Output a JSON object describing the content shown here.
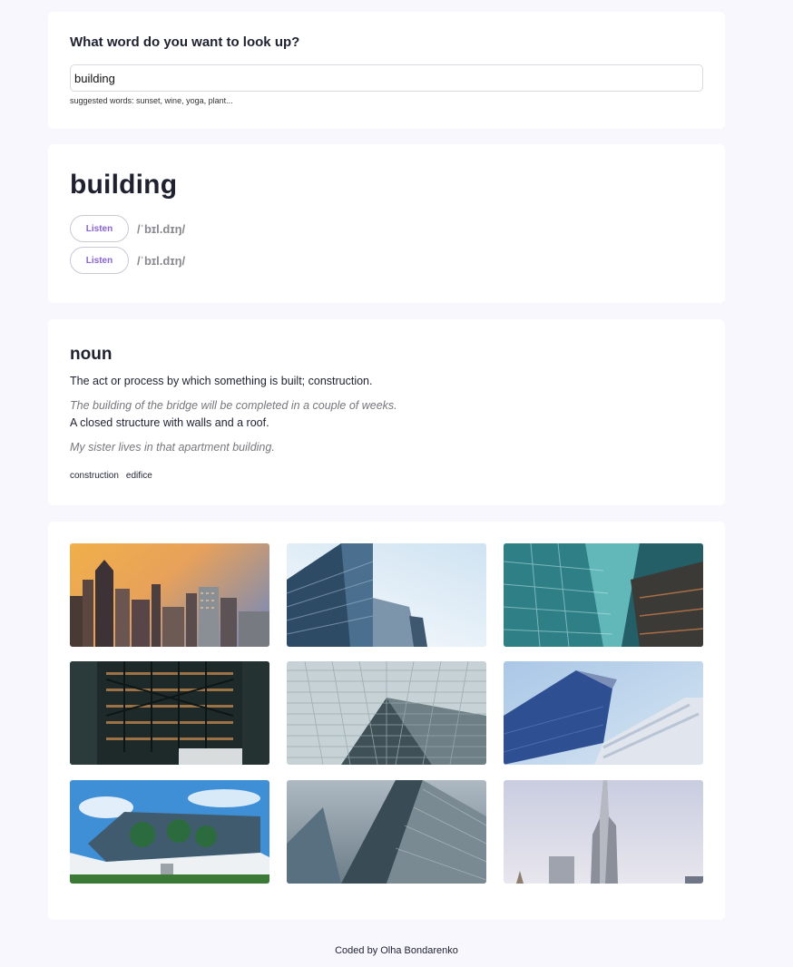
{
  "search": {
    "heading": "What word do you want to look up?",
    "value": "building",
    "suggestions": "suggested words: sunset, wine, yoga, plant..."
  },
  "word": {
    "title": "building",
    "phonetics": [
      {
        "button_label": "Listen",
        "text": "/ˈbɪl.dɪŋ/"
      },
      {
        "button_label": "Listen",
        "text": "/ˈbɪl.dɪŋ/"
      }
    ]
  },
  "meaning": {
    "part_of_speech": "noun",
    "definitions": [
      {
        "definition": "The act or process by which something is built; construction.",
        "example": "The building of the bridge will be completed in a couple of weeks."
      },
      {
        "definition": "A closed structure with walls and a roof.",
        "example": "My sister lives in that apartment building."
      }
    ],
    "synonyms": [
      "construction",
      "edifice"
    ]
  },
  "photos": [
    {
      "name": "city-skyline-sunset-photo"
    },
    {
      "name": "blue-glass-tower-photo"
    },
    {
      "name": "teal-glass-facade-photo"
    },
    {
      "name": "dark-office-building-photo"
    },
    {
      "name": "glass-grid-skyscraper-photo"
    },
    {
      "name": "modern-angular-building-photo"
    },
    {
      "name": "glass-office-trees-photo"
    },
    {
      "name": "curved-skyscraper-photo"
    },
    {
      "name": "burj-tower-photo"
    }
  ],
  "footer": {
    "text": "Coded by Olha Bondarenko"
  }
}
